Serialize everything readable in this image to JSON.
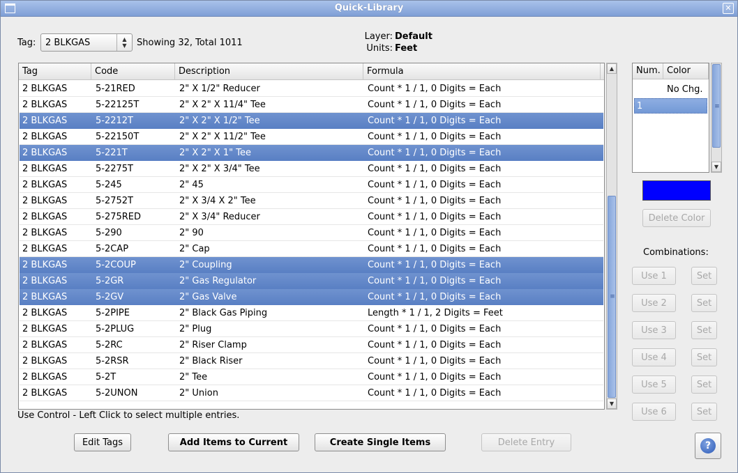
{
  "window": {
    "title": "Quick-Library"
  },
  "tag": {
    "label": "Tag:",
    "value": "2 BLKGAS",
    "status": "Showing 32, Total 1011"
  },
  "layer": {
    "label": "Layer:",
    "value": "Default"
  },
  "units": {
    "label": "Units:",
    "value": "Feet"
  },
  "table": {
    "headers": [
      "Tag",
      "Code",
      "Description",
      "Formula"
    ],
    "rows": [
      {
        "tag": "2 BLKGAS",
        "code": "5-21RED",
        "desc": "2\" X 1/2\" Reducer",
        "formula": "Count * 1 / 1,  0 Digits = Each",
        "selected": false
      },
      {
        "tag": "2 BLKGAS",
        "code": "5-22125T",
        "desc": "2\" X 2\" X 11/4\" Tee",
        "formula": "Count * 1 / 1,  0 Digits = Each",
        "selected": false
      },
      {
        "tag": "2 BLKGAS",
        "code": "5-2212T",
        "desc": "2\" X 2\" X 1/2\" Tee",
        "formula": "Count * 1 / 1,  0 Digits = Each",
        "selected": true
      },
      {
        "tag": "2 BLKGAS",
        "code": "5-22150T",
        "desc": "2\" X 2\" X 11/2\" Tee",
        "formula": "Count * 1 / 1,  0 Digits = Each",
        "selected": false
      },
      {
        "tag": "2 BLKGAS",
        "code": "5-221T",
        "desc": "2\" X 2\" X 1\" Tee",
        "formula": "Count * 1 / 1,  0 Digits = Each",
        "selected": true
      },
      {
        "tag": "2 BLKGAS",
        "code": "5-2275T",
        "desc": "2\" X 2\" X 3/4\" Tee",
        "formula": "Count * 1 / 1,  0 Digits = Each",
        "selected": false
      },
      {
        "tag": "2 BLKGAS",
        "code": "5-245",
        "desc": "2\" 45",
        "formula": "Count * 1 / 1,  0 Digits = Each",
        "selected": false
      },
      {
        "tag": "2 BLKGAS",
        "code": "5-2752T",
        "desc": "2\" X 3/4 X 2\" Tee",
        "formula": "Count * 1 / 1,  0 Digits = Each",
        "selected": false
      },
      {
        "tag": "2 BLKGAS",
        "code": "5-275RED",
        "desc": "2\" X 3/4\" Reducer",
        "formula": "Count * 1 / 1,  0 Digits = Each",
        "selected": false
      },
      {
        "tag": "2 BLKGAS",
        "code": "5-290",
        "desc": "2\" 90",
        "formula": "Count * 1 / 1,  0 Digits = Each",
        "selected": false
      },
      {
        "tag": "2 BLKGAS",
        "code": "5-2CAP",
        "desc": "2\" Cap",
        "formula": "Count * 1 / 1,  0 Digits = Each",
        "selected": false
      },
      {
        "tag": "2 BLKGAS",
        "code": "5-2COUP",
        "desc": "2\" Coupling",
        "formula": "Count * 1 / 1,  0 Digits = Each",
        "selected": true
      },
      {
        "tag": "2 BLKGAS",
        "code": "5-2GR",
        "desc": "2\" Gas Regulator",
        "formula": "Count * 1 / 1,  0 Digits = Each",
        "selected": true
      },
      {
        "tag": "2 BLKGAS",
        "code": "5-2GV",
        "desc": "2\" Gas Valve",
        "formula": "Count * 1 / 1,  0 Digits = Each",
        "selected": true
      },
      {
        "tag": "2 BLKGAS",
        "code": "5-2PIPE",
        "desc": "2\" Black Gas Piping",
        "formula": "Length * 1 / 1,  2 Digits = Feet",
        "selected": false
      },
      {
        "tag": "2 BLKGAS",
        "code": "5-2PLUG",
        "desc": "2\" Plug",
        "formula": "Count * 1 / 1,  0 Digits = Each",
        "selected": false
      },
      {
        "tag": "2 BLKGAS",
        "code": "5-2RC",
        "desc": "2\" Riser Clamp",
        "formula": "Count * 1 / 1,  0 Digits = Each",
        "selected": false
      },
      {
        "tag": "2 BLKGAS",
        "code": "5-2RSR",
        "desc": "2\" Black Riser",
        "formula": "Count * 1 / 1,  0 Digits = Each",
        "selected": false
      },
      {
        "tag": "2 BLKGAS",
        "code": "5-2T",
        "desc": "2\" Tee",
        "formula": "Count * 1 / 1,  0 Digits = Each",
        "selected": false
      },
      {
        "tag": "2 BLKGAS",
        "code": "5-2UNON",
        "desc": "2\"  Union",
        "formula": "Count * 1 / 1,  0 Digits = Each",
        "selected": false
      }
    ]
  },
  "hint": "Use Control - Left Click to select multiple entries.",
  "buttons": {
    "edit_tags": "Edit Tags",
    "add_items": "Add Items to Current",
    "create_single": "Create Single Items",
    "delete_entry": "Delete Entry",
    "delete_color": "Delete Color"
  },
  "color_list": {
    "headers": [
      "Num.",
      "Color"
    ],
    "items": [
      {
        "num": "",
        "color": "No Chg.",
        "selected": false
      },
      {
        "num": "1",
        "color": "",
        "selected": true
      }
    ],
    "current_color": "#0000ff"
  },
  "combinations": {
    "label": "Combinations:",
    "use": [
      "Use 1",
      "Use 2",
      "Use 3",
      "Use 4",
      "Use 5",
      "Use 6"
    ],
    "set": "Set"
  },
  "colors": {
    "selection": "#5f86c8",
    "title_bar": "#8fabdd"
  }
}
